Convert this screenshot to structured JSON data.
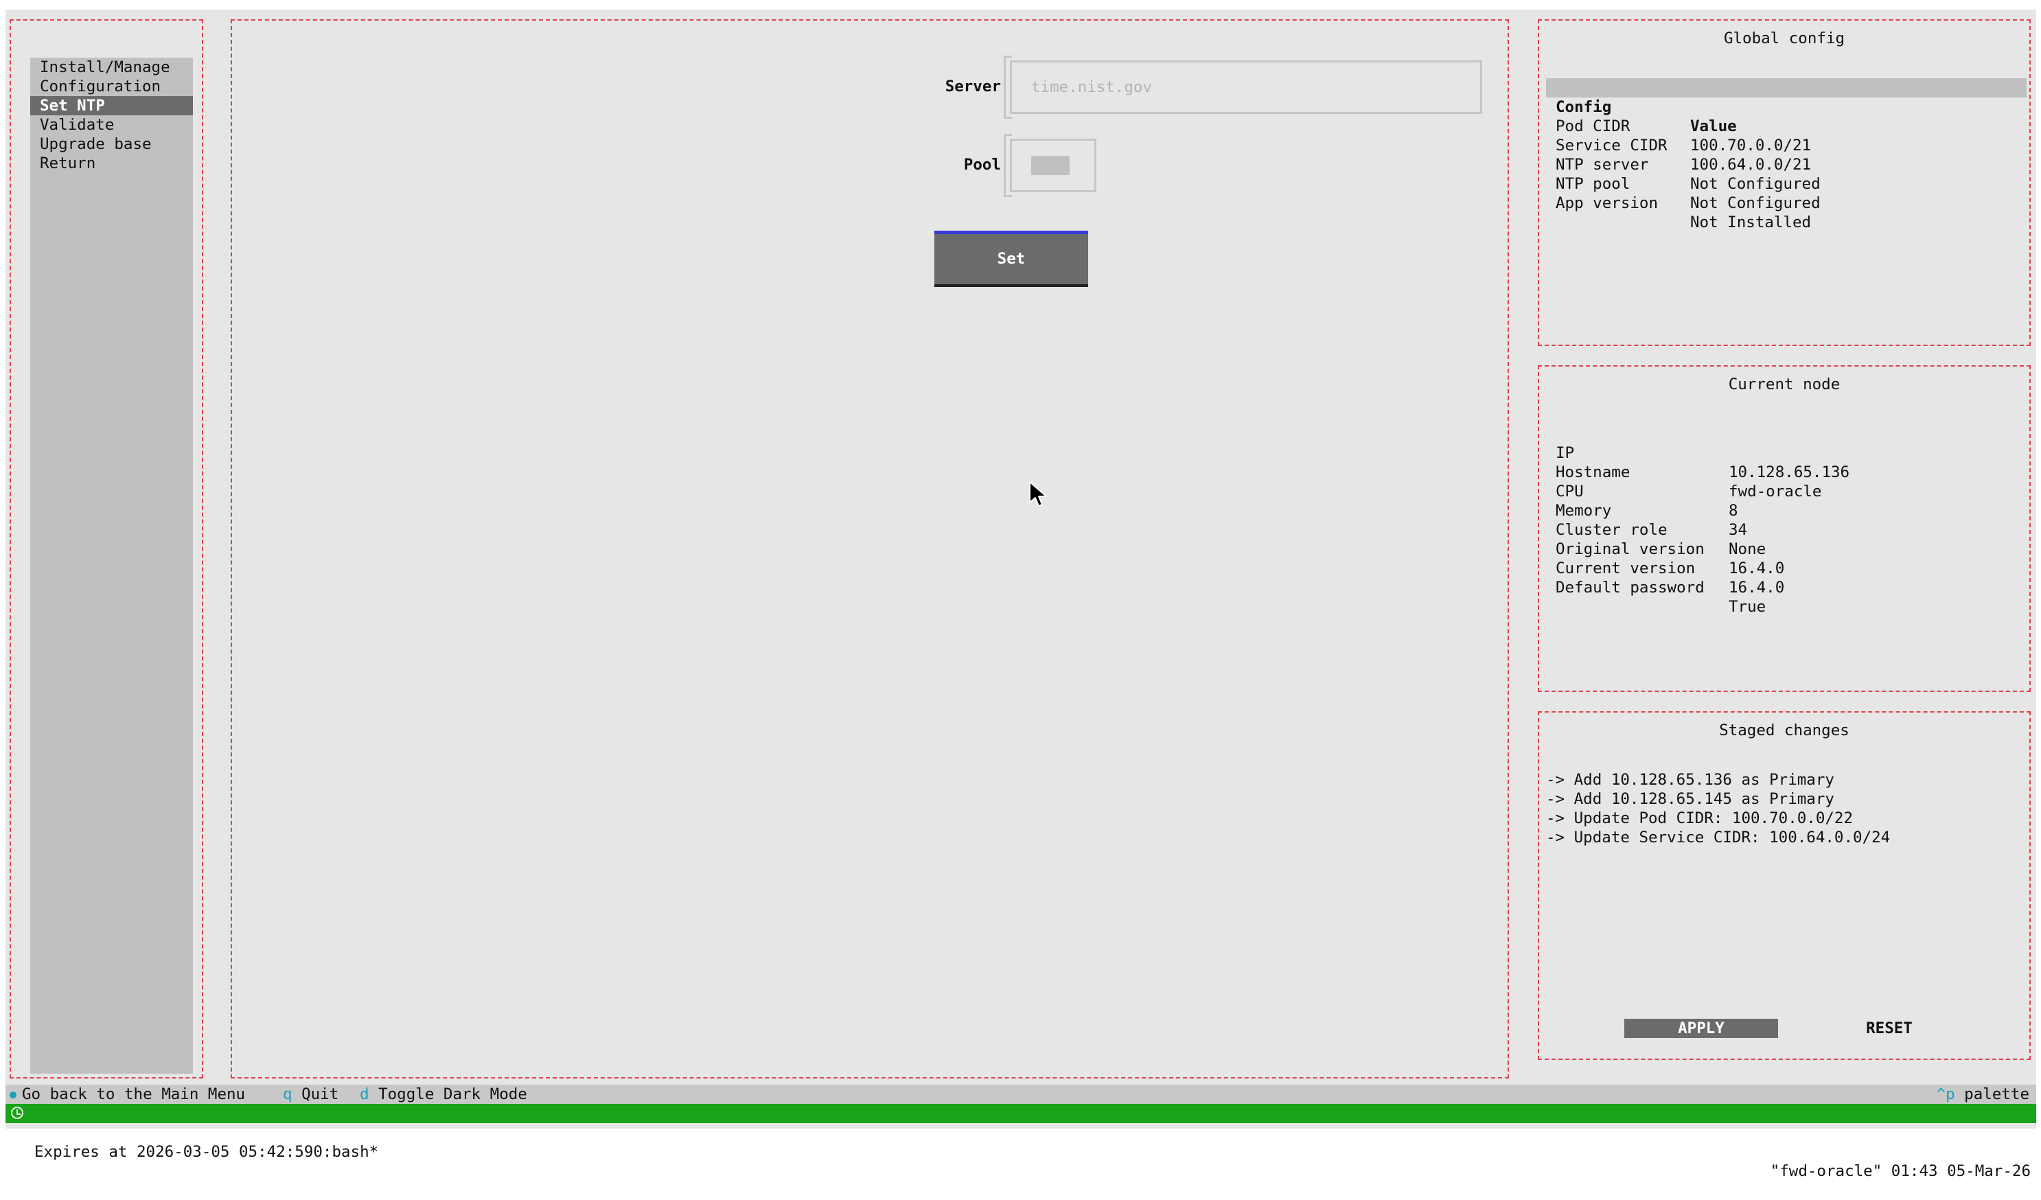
{
  "menu": {
    "items": [
      {
        "label": "Install/Manage"
      },
      {
        "label": "Configuration"
      },
      {
        "label": "Set NTP"
      },
      {
        "label": "Validate"
      },
      {
        "label": "Upgrade base"
      },
      {
        "label": "Return"
      }
    ],
    "selected": "Set NTP"
  },
  "ntp_form": {
    "server_label": "Server",
    "server_value": "",
    "server_placeholder": "time.nist.gov",
    "pool_label": "Pool",
    "pool_enabled": false,
    "set_label": "Set"
  },
  "global_config": {
    "title": "Global config",
    "headers": [
      "Config",
      "Value"
    ],
    "rows": [
      {
        "config": "Pod CIDR",
        "value": "100.70.0.0/21"
      },
      {
        "config": "Service CIDR",
        "value": "100.64.0.0/21"
      },
      {
        "config": "NTP server",
        "value": "Not Configured"
      },
      {
        "config": "NTP pool",
        "value": "Not Configured"
      },
      {
        "config": "App version",
        "value": "Not Installed"
      }
    ]
  },
  "current_node": {
    "title": "Current node",
    "rows": [
      {
        "key": "IP",
        "value": "10.128.65.136"
      },
      {
        "key": "Hostname",
        "value": "fwd-oracle"
      },
      {
        "key": "CPU",
        "value": "8"
      },
      {
        "key": "Memory",
        "value": "34"
      },
      {
        "key": "Cluster role",
        "value": "None"
      },
      {
        "key": "Original version",
        "value": "16.4.0"
      },
      {
        "key": "Current version",
        "value": "16.4.0"
      },
      {
        "key": "Default password",
        "value": "True"
      }
    ]
  },
  "staged_changes": {
    "title": "Staged changes",
    "items": [
      "-> Add 10.128.65.136 as Primary",
      "-> Add 10.128.65.145 as Primary",
      "-> Update Pod CIDR: 100.70.0.0/22",
      "-> Update Service CIDR: 100.64.0.0/24"
    ],
    "apply_label": "APPLY",
    "reset_label": "RESET"
  },
  "footer": {
    "back_label": "Go back to the Main Menu",
    "quit_key": "q",
    "quit_label": "Quit",
    "dark_key": "d",
    "dark_label": "Toggle Dark Mode",
    "palette_key": "^p",
    "palette_label": "palette"
  },
  "tmux": {
    "left_text": "Expires at 2026-03-05 05:42:590:bash*",
    "right_text": "\"fwd-oracle\" 01:43 05-Mar-26"
  },
  "colors": {
    "panel_border": "#e0414c",
    "background": "#e6e6e6",
    "selection": "#6b6b6b",
    "key_accent": "#1aa0b8",
    "status_bar": "#18a318"
  },
  "icons": [
    "back-dot-icon",
    "clock-icon",
    "mouse-pointer-icon"
  ]
}
